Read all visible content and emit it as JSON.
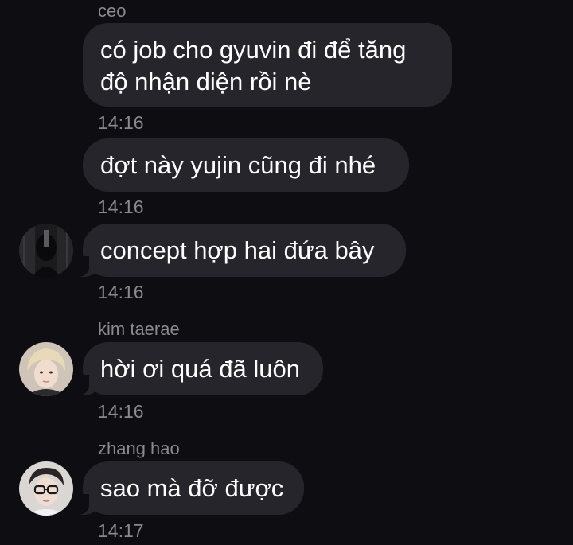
{
  "messages": [
    {
      "sender": "ceo",
      "lines": [
        "có job cho gyuvin đi để tăng",
        "độ nhận diện rồi nè"
      ],
      "time": "14:16"
    },
    {
      "sender": "",
      "lines": [
        "đợt này yujin cũng đi nhé"
      ],
      "time": "14:16"
    },
    {
      "sender": "",
      "lines": [
        "concept hợp hai đứa bây"
      ],
      "time": "14:16"
    },
    {
      "sender": "kim taerae",
      "lines": [
        "hời ơi quá đã luôn"
      ],
      "time": "14:16"
    },
    {
      "sender": "zhang hao",
      "lines": [
        "sao mà đỡ được"
      ],
      "time": "14:17"
    }
  ],
  "avatars": {
    "ceo": "dark-portrait-avatar",
    "kim_taerae": "blonde-portrait-avatar",
    "zhang_hao": "glasses-portrait-avatar"
  },
  "colors": {
    "background": "#0e0d12",
    "bubble": "#26252b",
    "meta_text": "#8a8990",
    "message_text": "#ffffff"
  }
}
